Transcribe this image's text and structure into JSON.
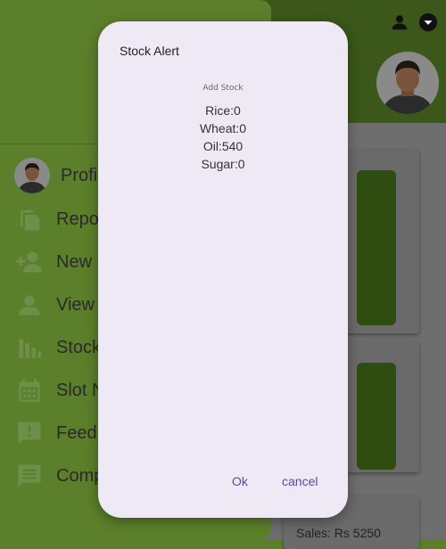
{
  "drawer": {
    "items": [
      {
        "label": "Profi",
        "icon": "profile-avatar"
      },
      {
        "label": "Repo",
        "icon": "reports-icon"
      },
      {
        "label": "New",
        "icon": "add-user-icon"
      },
      {
        "label": "View",
        "icon": "person-icon"
      },
      {
        "label": "Stock",
        "icon": "stock-chart-icon"
      },
      {
        "label": "Slot N",
        "icon": "calendar-icon"
      },
      {
        "label": "Feed",
        "icon": "feedback-icon"
      },
      {
        "label": "Comp",
        "icon": "complaint-icon"
      }
    ]
  },
  "background": {
    "sales_text": "Sales: Rs 5250",
    "header_icons": [
      "account-icon",
      "dropdown-icon"
    ]
  },
  "dialog": {
    "title": "Stock Alert",
    "subtitle": "Add Stock",
    "items": [
      "Rice:0",
      "Wheat:0",
      "Oil:540",
      "Sugar:0"
    ],
    "ok_label": "Ok",
    "cancel_label": "cancel"
  },
  "colors": {
    "drawer": "#5b7f2a",
    "header": "#3b571a",
    "dialog_bg": "#efe9f5",
    "accent_text": "#5a4b96"
  }
}
